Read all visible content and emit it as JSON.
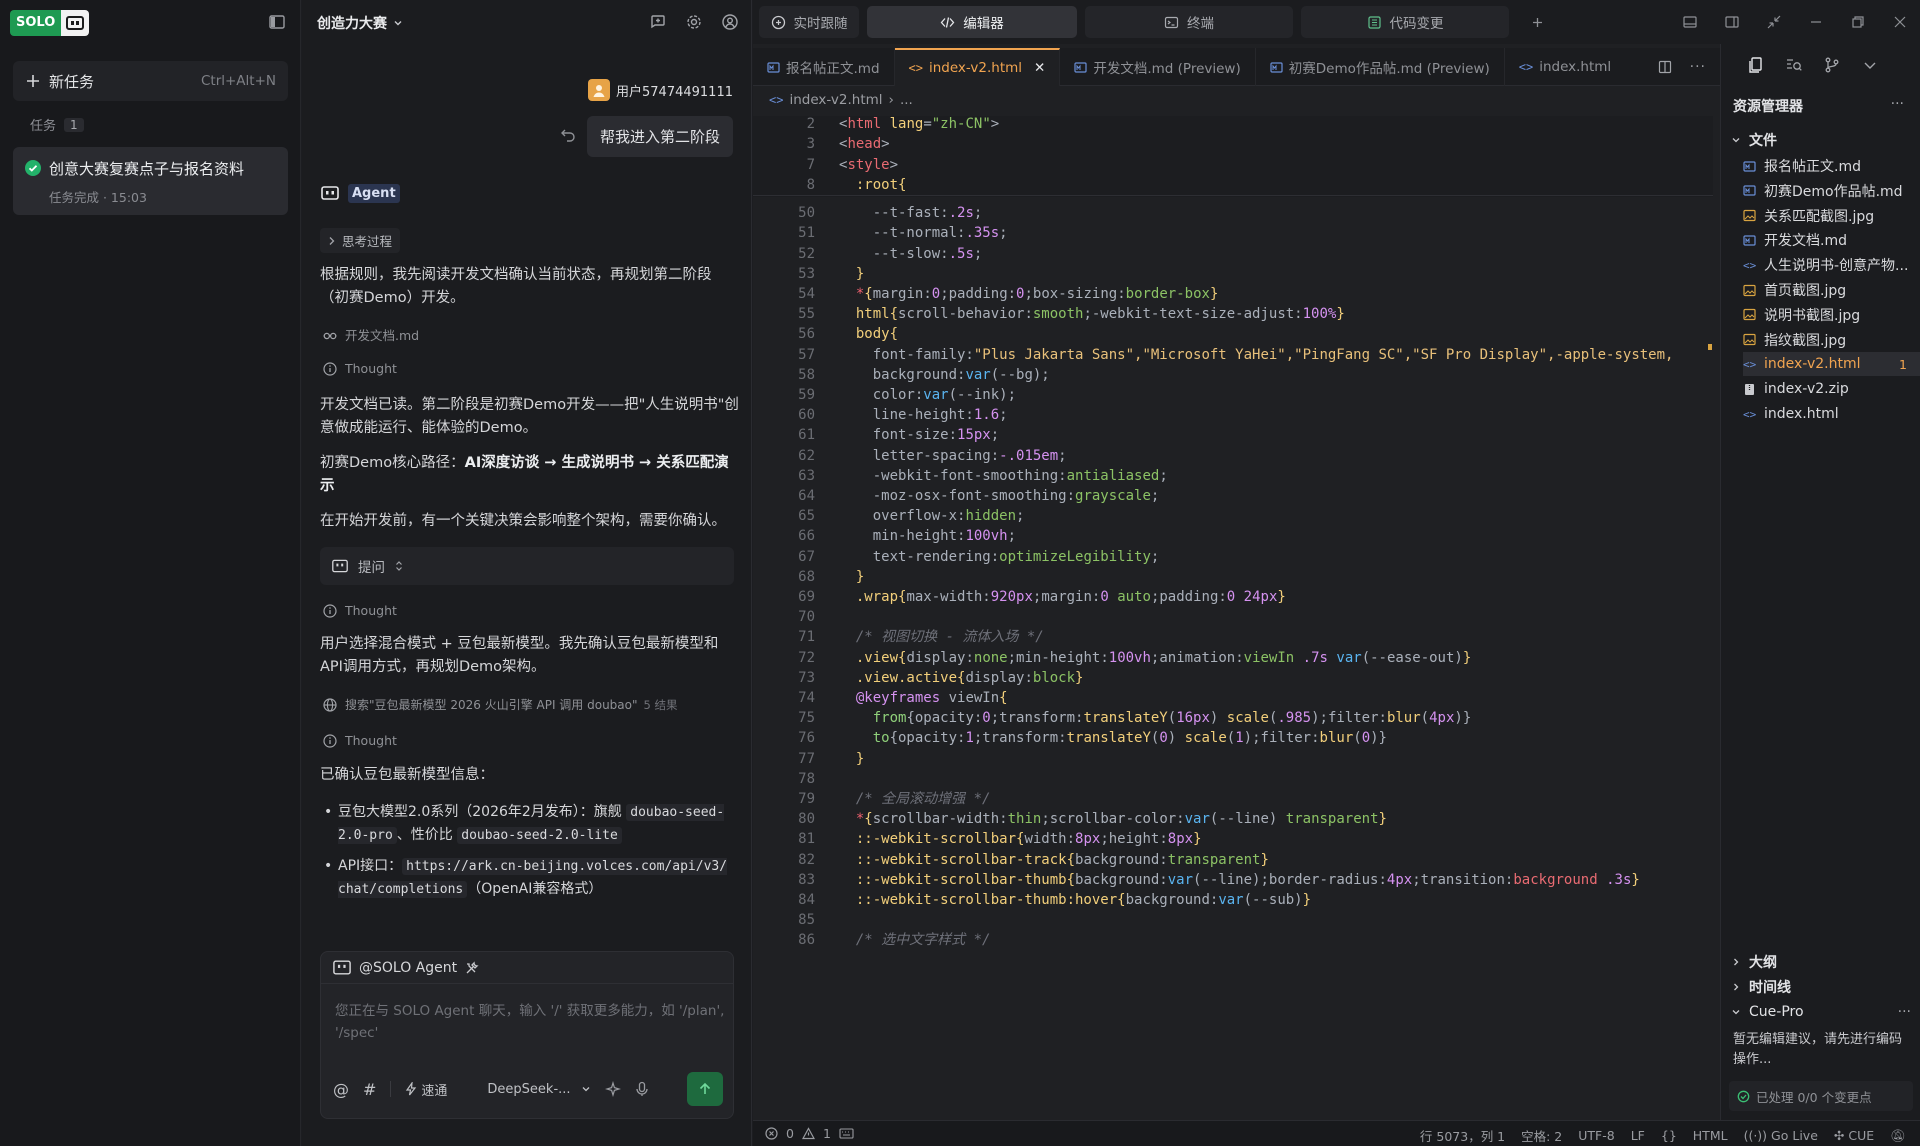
{
  "left": {
    "brand": "SOLO",
    "new_task": {
      "label": "新任务",
      "shortcut": "Ctrl+Alt+N"
    },
    "tasks_header": "任务",
    "tasks_count": "1",
    "task": {
      "title": "创意大赛复赛点子与报名资料",
      "status": "任务完成 · 15:03"
    }
  },
  "chat": {
    "title": "创造力大赛",
    "user_name": "用户57474491111",
    "user_message": "帮我进入第二阶段",
    "agent_label": "Agent",
    "thinking_pill": "思考过程",
    "para1": "根据规则，我先阅读开发文档确认当前状态，再规划第二阶段（初赛Demo）开发。",
    "read_file": "开发文档.md",
    "thought_label": "Thought",
    "para2": "开发文档已读。第二阶段是初赛Demo开发——把\"人生说明书\"创意做成能运行、能体验的Demo。",
    "para3_prefix": "初赛Demo核心路径：",
    "para3_bold": "AI深度访谈 → 生成说明书 → 关系匹配演示",
    "para4": "在开始开发前，有一个关键决策会影响整个架构，需要你确认。",
    "ask_label": "提问",
    "para5": "用户选择混合模式 + 豆包最新模型。我先确认豆包最新模型和API调用方式，再规划Demo架构。",
    "search_text": "搜索\"豆包最新模型 2026 火山引擎 API 调用 doubao\"",
    "search_count": "5 结果",
    "para6": "已确认豆包最新模型信息：",
    "bullet1_text": "豆包大模型2.0系列（2026年2月发布）：旗舰",
    "bullet1_code1": "doubao-seed-2.0-pro",
    "bullet1_mid": "、性价比",
    "bullet1_code2": "doubao-seed-2.0-lite",
    "bullet2_prefix": "API接口：",
    "bullet2_code": "https://ark.cn-beijing.volces.com/api/v3/chat/completions",
    "bullet2_suffix": "（OpenAI兼容格式）",
    "composer": {
      "header": "@SOLO Agent",
      "placeholder": "您正在与 SOLO Agent 聊天，输入 '/' 获取更多能力，如 '/plan', '/spec'",
      "speed_label": "速通",
      "model": "DeepSeek-..."
    }
  },
  "editor": {
    "top_tabs": [
      "实时跟随",
      "编辑器",
      "终端",
      "代码变更"
    ],
    "file_tabs": [
      {
        "label": "报名帖正文.md"
      },
      {
        "label": "index-v2.html"
      },
      {
        "label": "开发文档.md (Preview)"
      },
      {
        "label": "初赛Demo作品帖.md (Preview)"
      },
      {
        "label": "index.html"
      }
    ],
    "breadcrumb": "index-v2.html",
    "breadcrumb_more": "...",
    "sticky_lines": [
      {
        "n": "2",
        "html": "<span class='p'>&lt;</span><span class='t'>html</span> <span class='y'>lang</span><span class='p'>=</span><span class='s'>\"zh-CN\"</span><span class='p'>&gt;</span>"
      },
      {
        "n": "3",
        "html": "<span class='p'>&lt;</span><span class='t'>head</span><span class='p'>&gt;</span>"
      },
      {
        "n": "7",
        "html": "<span class='p'>&lt;</span><span class='t'>style</span><span class='p'>&gt;</span>"
      },
      {
        "n": "8",
        "html": "  <span class='y'>:root</span><span class='y'>{</span>"
      }
    ],
    "lines": [
      {
        "n": "50",
        "html": "    <span class='p'>--t-fast</span><span class='p'>:</span><span class='n'>.2s</span><span class='p'>;</span>"
      },
      {
        "n": "51",
        "html": "    <span class='p'>--t-normal</span><span class='p'>:</span><span class='n'>.35s</span><span class='p'>;</span>"
      },
      {
        "n": "52",
        "html": "    <span class='p'>--t-slow</span><span class='p'>:</span><span class='n'>.5s</span><span class='p'>;</span>"
      },
      {
        "n": "53",
        "html": "  <span class='y'>}</span>"
      },
      {
        "n": "54",
        "html": "  <span class='k'>*</span><span class='y'>{</span><span class='p'>margin</span><span class='p'>:</span><span class='n'>0</span><span class='p'>;padding:</span><span class='n'>0</span><span class='p'>;box-sizing:</span><span class='s'>border-box</span><span class='y'>}</span>"
      },
      {
        "n": "55",
        "html": "  <span class='y'>html</span><span class='y'>{</span><span class='p'>scroll-behavior:</span><span class='s'>smooth</span><span class='p'>;-webkit-text-size-adjust:</span><span class='n'>100%</span><span class='y'>}</span>"
      },
      {
        "n": "56",
        "html": "  <span class='y'>body</span><span class='y'>{</span>"
      },
      {
        "n": "57",
        "html": "    <span class='p'>font-family:</span><span class='v'>\"Plus Jakarta Sans\",\"Microsoft YaHei\",\"PingFang SC\",\"SF Pro Display\",-apple-system,</span>"
      },
      {
        "n": "58",
        "html": "    <span class='p'>background:</span><span class='f'>var</span><span class='p'>(--bg);</span>"
      },
      {
        "n": "59",
        "html": "    <span class='p'>color:</span><span class='f'>var</span><span class='p'>(--ink);</span>"
      },
      {
        "n": "60",
        "html": "    <span class='p'>line-height:</span><span class='n'>1.6</span><span class='p'>;</span>"
      },
      {
        "n": "61",
        "html": "    <span class='p'>font-size:</span><span class='n'>15px</span><span class='p'>;</span>"
      },
      {
        "n": "62",
        "html": "    <span class='p'>letter-spacing:</span><span class='n'>-.015em</span><span class='p'>;</span>"
      },
      {
        "n": "63",
        "html": "    <span class='p'>-webkit-font-smoothing:</span><span class='s'>antialiased</span><span class='p'>;</span>"
      },
      {
        "n": "64",
        "html": "    <span class='p'>-moz-osx-font-smoothing:</span><span class='s'>grayscale</span><span class='p'>;</span>"
      },
      {
        "n": "65",
        "html": "    <span class='p'>overflow-x:</span><span class='s'>hidden</span><span class='p'>;</span>"
      },
      {
        "n": "66",
        "html": "    <span class='p'>min-height:</span><span class='n'>100vh</span><span class='p'>;</span>"
      },
      {
        "n": "67",
        "html": "    <span class='p'>text-rendering:</span><span class='s'>optimizeLegibility</span><span class='p'>;</span>"
      },
      {
        "n": "68",
        "html": "  <span class='y'>}</span>"
      },
      {
        "n": "69",
        "html": "  <span class='y'>.wrap</span><span class='y'>{</span><span class='p'>max-width:</span><span class='n'>920px</span><span class='p'>;margin:</span><span class='n'>0</span> <span class='s'>auto</span><span class='p'>;padding:</span><span class='n'>0 24px</span><span class='y'>}</span>"
      },
      {
        "n": "70",
        "html": ""
      },
      {
        "n": "71",
        "html": "  <span class='c'>/* 视图切换 - 流体入场 */</span>"
      },
      {
        "n": "72",
        "html": "  <span class='y'>.view</span><span class='y'>{</span><span class='p'>display:</span><span class='s'>none</span><span class='p'>;min-height:</span><span class='n'>100vh</span><span class='p'>;animation:</span><span class='s'>viewIn</span> <span class='n'>.7s</span> <span class='f'>var</span><span class='p'>(--ease-out)</span><span class='y'>}</span>"
      },
      {
        "n": "73",
        "html": "  <span class='y'>.view.active</span><span class='y'>{</span><span class='p'>display:</span><span class='s'>block</span><span class='y'>}</span>"
      },
      {
        "n": "74",
        "html": "  <span class='n'>@keyframes</span> <span class='p'>viewIn</span><span class='y'>{</span>"
      },
      {
        "n": "75",
        "html": "    <span class='g'>from</span><span class='p'>{opacity:</span><span class='n'>0</span><span class='p'>;transform:</span><span class='y'>translateY</span><span class='p'>(</span><span class='n'>16px</span><span class='p'>)</span> <span class='y'>scale</span><span class='p'>(</span><span class='n'>.985</span><span class='p'>);filter:</span><span class='y'>blur</span><span class='p'>(</span><span class='n'>4px</span><span class='p'>)}</span>"
      },
      {
        "n": "76",
        "html": "    <span class='g'>to</span><span class='p'>{opacity:</span><span class='n'>1</span><span class='p'>;transform:</span><span class='y'>translateY</span><span class='p'>(</span><span class='n'>0</span><span class='p'>)</span> <span class='y'>scale</span><span class='p'>(</span><span class='n'>1</span><span class='p'>);filter:</span><span class='y'>blur</span><span class='p'>(</span><span class='n'>0</span><span class='p'>)}</span>"
      },
      {
        "n": "77",
        "html": "  <span class='y'>}</span>"
      },
      {
        "n": "78",
        "html": ""
      },
      {
        "n": "79",
        "html": "  <span class='c'>/* 全局滚动增强 */</span>"
      },
      {
        "n": "80",
        "html": "  <span class='k'>*</span><span class='y'>{</span><span class='p'>scrollbar-width:</span><span class='s'>thin</span><span class='p'>;scrollbar-color:</span><span class='f'>var</span><span class='p'>(--line)</span> <span class='s'>transparent</span><span class='y'>}</span>"
      },
      {
        "n": "81",
        "html": "  <span class='y'>::-webkit-scrollbar</span><span class='y'>{</span><span class='p'>width:</span><span class='n'>8px</span><span class='p'>;height:</span><span class='n'>8px</span><span class='y'>}</span>"
      },
      {
        "n": "82",
        "html": "  <span class='y'>::-webkit-scrollbar-track</span><span class='y'>{</span><span class='p'>background:</span><span class='s'>transparent</span><span class='y'>}</span>"
      },
      {
        "n": "83",
        "html": "  <span class='y'>::-webkit-scrollbar-thumb</span><span class='y'>{</span><span class='p'>background:</span><span class='f'>var</span><span class='p'>(--line);border-radius:</span><span class='n'>4px</span><span class='p'>;transition:</span><span class='t'>background</span> <span class='n'>.3s</span><span class='y'>}</span>"
      },
      {
        "n": "84",
        "html": "  <span class='y'>::-webkit-scrollbar-thumb:hover</span><span class='y'>{</span><span class='p'>background:</span><span class='f'>var</span><span class='p'>(--sub)</span><span class='y'>}</span>"
      },
      {
        "n": "85",
        "html": ""
      },
      {
        "n": "86",
        "html": "  <span class='c'>/* 选中文字样式 */</span>"
      }
    ]
  },
  "explorer": {
    "title": "资源管理器",
    "folder": "文件",
    "files": [
      {
        "name": "报名帖正文.md",
        "icon": "md"
      },
      {
        "name": "初赛Demo作品帖.md",
        "icon": "md"
      },
      {
        "name": "关系匹配截图.jpg",
        "icon": "img"
      },
      {
        "name": "开发文档.md",
        "icon": "md"
      },
      {
        "name": "人生说明书-创意产物...",
        "icon": "html"
      },
      {
        "name": "首页截图.jpg",
        "icon": "img"
      },
      {
        "name": "说明书截图.jpg",
        "icon": "img"
      },
      {
        "name": "指纹截图.jpg",
        "icon": "img"
      },
      {
        "name": "index-v2.html",
        "icon": "html",
        "badge": "1"
      },
      {
        "name": "index-v2.zip",
        "icon": "zip"
      },
      {
        "name": "index.html",
        "icon": "html"
      }
    ],
    "outline": "大纲",
    "timeline": "时间线",
    "cue_pro": "Cue-Pro",
    "cue_text": "暂无编辑建议，请先进行编码操作...",
    "cue_footer": "已处理 0/0 个变更点"
  },
  "status": {
    "errors": "0",
    "warnings": "1",
    "position": "行 5073，列 1",
    "spaces": "空格: 2",
    "encoding": "UTF-8",
    "eol": "LF",
    "language": "HTML",
    "golive": "Go Live",
    "cue": "CUE"
  }
}
